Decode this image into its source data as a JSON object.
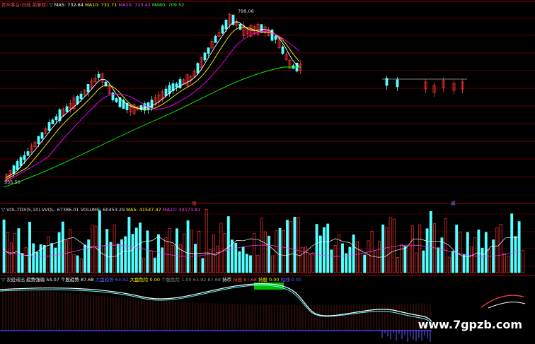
{
  "colors": {
    "background": "#000000",
    "up": "#ff3232",
    "down": "#54ffff",
    "ma5": "#ffffff",
    "ma10": "#ffff00",
    "ma20": "#ff00ff",
    "ma60": "#00ff00",
    "grid": "#800000",
    "label_blue": "#6060ff",
    "green_fill": "#00ff00"
  },
  "price_panel": {
    "prefix": "贵州茅台(日线 前复权)",
    "indicator_icon": "triangle-down-icon",
    "ma5": "MA5: 732.84",
    "ma10": "MA10: 731.71",
    "ma20": "MA20: 723.42",
    "ma60": "MA60: 709.52",
    "high_label": "799.06",
    "low_label": "535.50"
  },
  "volume_panel": {
    "indicator_icon": "triangle-down-icon",
    "name": "VOL-TDX(5,10)",
    "vvol": "VVOL: 67386.01",
    "volume": "VOLUME: 60453.29",
    "ma5": "MA5: 41547.47",
    "ma10": "MA10: 34173.81"
  },
  "signal_marks": {
    "left": "增",
    "right": "减"
  },
  "indicator_panel": {
    "indicator_icon": "triangle-down-icon",
    "name": "农经诺出",
    "items": [
      {
        "label": "趋势强弱",
        "value": "54.07"
      },
      {
        "label": "个股趋势",
        "value": "87.68"
      },
      {
        "label": "大盘趋势",
        "value": "63.92"
      },
      {
        "label": "大盘危险",
        "value": "0.00"
      },
      {
        "label": "个股危险",
        "value": "1.00"
      },
      {
        "label": "",
        "value": "63.92"
      },
      {
        "label": "",
        "value": "87.68"
      },
      {
        "label": "持币",
        "value": ""
      },
      {
        "label": "持股",
        "value": "87.68"
      },
      {
        "label": "持股",
        "value": "0.00"
      },
      {
        "label": "短线",
        "value": "0.00"
      }
    ]
  },
  "watermark": "www.7gpzb.com"
}
